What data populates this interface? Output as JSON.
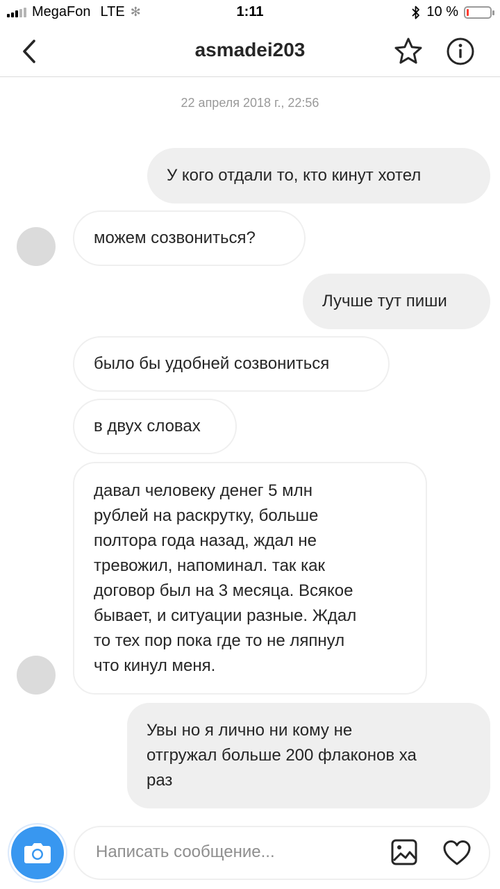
{
  "status_bar": {
    "carrier": "MegaFon",
    "network": "LTE",
    "time": "1:11",
    "battery_percent": "10 %",
    "battery_level": 0.1,
    "battery_color": "#ff3b30"
  },
  "header": {
    "title": "asmadei203",
    "back_icon": "chevron-left-icon",
    "star_icon": "star-icon",
    "info_icon": "info-icon"
  },
  "conversation": {
    "timestamp": "22 апреля 2018 г., 22:56",
    "messages": [
      {
        "direction": "outgoing",
        "lines": [
          "У кого отдали то, кто кинут хотел"
        ]
      },
      {
        "direction": "incoming",
        "lines": [
          "можем созвониться?"
        ]
      },
      {
        "direction": "outgoing",
        "lines": [
          "Лучше тут пиши"
        ]
      },
      {
        "direction": "incoming",
        "lines": [
          "было бы удобней созвониться"
        ]
      },
      {
        "direction": "incoming",
        "lines": [
          "в двух словах"
        ]
      },
      {
        "direction": "incoming",
        "lines": [
          "давал человеку денег 5 млн",
          "рублей на раскрутку, больше",
          "полтора года назад, ждал не",
          "тревожил, напоминал. так как",
          "договор был на 3 месяца. Всякое",
          "бывает, и ситуации разные. Ждал",
          "то тех пор пока где то не ляпнул",
          "что кинул меня."
        ]
      },
      {
        "direction": "outgoing",
        "lines": [
          "Увы но я лично ни кому не",
          "отгружал больше 200 флаконов ха",
          "раз"
        ]
      }
    ]
  },
  "composer": {
    "placeholder": "Написать сообщение...",
    "camera_icon": "camera-icon",
    "gallery_icon": "image-icon",
    "heart_icon": "heart-icon",
    "accent_color": "#3897f0"
  }
}
